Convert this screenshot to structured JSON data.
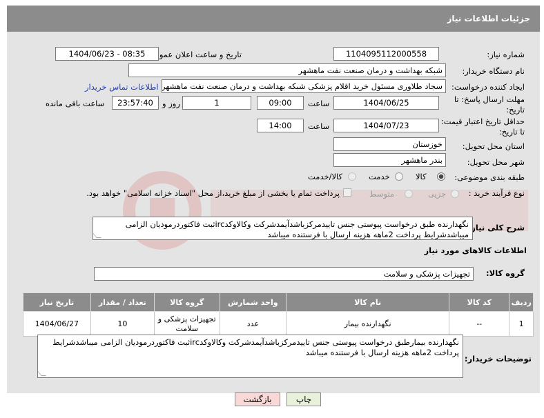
{
  "header": {
    "title": "جزئیات اطلاعات نیاز"
  },
  "form": {
    "need_number_label": "شماره نیاز:",
    "need_number": "1104095112000558",
    "announce_label": "تاریخ و ساعت اعلان عمومی:",
    "announce_value": "1404/06/23 - 08:35",
    "buyer_org_label": "نام دستگاه خریدار:",
    "buyer_org": "شبکه بهداشت و درمان صنعت نفت ماهشهر",
    "creator_label": "ایجاد کننده درخواست:",
    "creator": "سجاد طلاوری مسئول خرید اقلام پزشکی شبکه بهداشت و درمان صنعت نفت ماهشهر",
    "contact_link": "اطلاعات تماس خریدار",
    "reply_deadline_label_1": "مهلت ارسال پاسخ: تا",
    "reply_deadline_label_2": "تاریخ:",
    "reply_date": "1404/06/25",
    "time_label": "ساعت",
    "reply_time": "09:00",
    "days_value": "1",
    "days_label": "روز و",
    "remaining_time": "23:57:40",
    "remaining_label": "ساعت باقی مانده",
    "price_validity_label_1": "حداقل تاریخ اعتبار قیمت:",
    "price_validity_label_2": "تا تاریخ:",
    "price_date": "1404/07/23",
    "price_time": "14:00",
    "province_label": "استان محل تحویل:",
    "province": "خوزستان",
    "city_label": "شهر محل تحویل:",
    "city": "بندر ماهشهر",
    "category_label": "طبقه بندی موضوعی:",
    "category_options": [
      "کالا",
      "خدمت",
      "کالا/خدمت"
    ],
    "process_label": "نوع فرآیند خرید :",
    "process_options": [
      "جزیی",
      "متوسط"
    ],
    "payment_note": "پرداخت تمام یا بخشی از مبلغ خرید،از محل \"اسناد خزانه اسلامی\" خواهد بود.",
    "description_label": "شرح کلی نیاز:",
    "description": "نگهدارنده طبق درخواست پیوستی جنس تاییدمرکزباشدآیمدشرکت وکالاوکدircثبت فاکتوردرمودیان الزامی میباشدشرایط پرداخت 2ماهه هزینه ارسال با فرستنده میباشد"
  },
  "items_section": {
    "title": "اطلاعات کالاهای مورد نیاز",
    "group_label": "گروه کالا:",
    "group_value": "تجهیزات پزشکی و سلامت",
    "columns": [
      "ردیف",
      "کد کالا",
      "نام کالا",
      "واحد شمارش",
      "گروه کالا",
      "تعداد / مقدار",
      "تاریخ نیاز"
    ],
    "rows": [
      {
        "row": "1",
        "code": "--",
        "name": "نگهدارنده بیمار",
        "unit": "عدد",
        "group": "تجهیزات پزشکی و سلامت",
        "qty": "10",
        "date": "1404/06/27"
      }
    ],
    "buyer_notes_label": "توضیحات خریدار:",
    "buyer_notes": "نگهدارنده بیمارطبق درخواست پیوستی جنس تاییدمرکزباشدآیمدشرکت وکالاوکدircثبت فاکتوردرمودیان الزامی میباشدشرایط پرداخت 2ماهه هزینه ارسال با فرستنده میباشد"
  },
  "buttons": {
    "print": "چاپ",
    "back": "بازگشت"
  },
  "colors": {
    "header": "#8c8c8c",
    "panel": "#e4e4e4",
    "link": "#1a3cc8",
    "back_button": "#f9d8d8",
    "print_button": "#e8f2da"
  }
}
